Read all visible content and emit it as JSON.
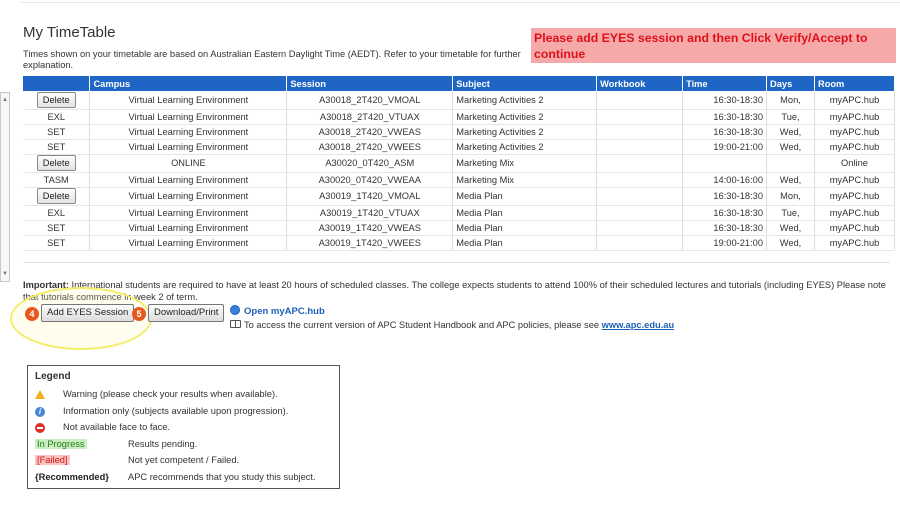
{
  "page": {
    "title": "My TimeTable",
    "subtitle": "Times shown on your timetable are based on Australian Eastern Daylight Time (AEDT). Refer to your timetable for further explanation.",
    "alert": "Please add EYES session and then Click Verify/Accept to continue"
  },
  "table": {
    "headers": [
      "",
      "Campus",
      "Session",
      "Subject",
      "Workbook",
      "Time",
      "Days",
      "Room"
    ],
    "rows": [
      {
        "action": "Delete",
        "campus": "Virtual Learning Environment",
        "session": "A30018_2T420_VMOAL",
        "subject": "Marketing Activities 2",
        "workbook": "",
        "time": "16:30-18:30",
        "days": "Mon,",
        "room": "myAPC.hub"
      },
      {
        "action": "EXL",
        "campus": "Virtual Learning Environment",
        "session": "A30018_2T420_VTUAX",
        "subject": "Marketing Activities 2",
        "workbook": "",
        "time": "16:30-18:30",
        "days": "Tue,",
        "room": "myAPC.hub"
      },
      {
        "action": "SET",
        "campus": "Virtual Learning Environment",
        "session": "A30018_2T420_VWEAS",
        "subject": "Marketing Activities 2",
        "workbook": "",
        "time": "16:30-18:30",
        "days": "Wed,",
        "room": "myAPC.hub"
      },
      {
        "action": "SET",
        "campus": "Virtual Learning Environment",
        "session": "A30018_2T420_VWEES",
        "subject": "Marketing Activities 2",
        "workbook": "",
        "time": "19:00-21:00",
        "days": "Wed,",
        "room": "myAPC.hub"
      },
      {
        "action": "Delete",
        "campus": "ONLINE",
        "session": "A30020_0T420_ASM",
        "subject": "Marketing Mix",
        "workbook": "",
        "time": "",
        "days": "",
        "room": "Online"
      },
      {
        "action": "TASM",
        "campus": "Virtual Learning Environment",
        "session": "A30020_0T420_VWEAA",
        "subject": "Marketing Mix",
        "workbook": "",
        "time": "14:00-16:00",
        "days": "Wed,",
        "room": "myAPC.hub"
      },
      {
        "action": "Delete",
        "campus": "Virtual Learning Environment",
        "session": "A30019_1T420_VMOAL",
        "subject": "Media Plan",
        "workbook": "",
        "time": "16:30-18:30",
        "days": "Mon,",
        "room": "myAPC.hub"
      },
      {
        "action": "EXL",
        "campus": "Virtual Learning Environment",
        "session": "A30019_1T420_VTUAX",
        "subject": "Media Plan",
        "workbook": "",
        "time": "16:30-18:30",
        "days": "Tue,",
        "room": "myAPC.hub"
      },
      {
        "action": "SET",
        "campus": "Virtual Learning Environment",
        "session": "A30019_1T420_VWEAS",
        "subject": "Media Plan",
        "workbook": "",
        "time": "16:30-18:30",
        "days": "Wed,",
        "room": "myAPC.hub"
      },
      {
        "action": "SET",
        "campus": "Virtual Learning Environment",
        "session": "A30019_1T420_VWEES",
        "subject": "Media Plan",
        "workbook": "",
        "time": "19:00-21:00",
        "days": "Wed,",
        "room": "myAPC.hub"
      }
    ]
  },
  "note": {
    "bold": "Important:",
    "text": " International students are required to have at least 20 hours of scheduled classes. The college expects students to attend 100% of their scheduled lectures and tutorials (including EYES) Please note that tutorials commence in week 2 of term."
  },
  "actions": {
    "step_a": "4",
    "add_eyes": "Add EYES Session",
    "step_b": "5",
    "download": "Download/Print",
    "open_link": "Open myAPC.hub",
    "handbook_text": "To access the current version of APC Student Handbook and APC policies, please see ",
    "handbook_link": "www.apc.edu.au"
  },
  "legend": {
    "title": "Legend",
    "warning": "Warning (please check your results when available).",
    "info": "Information only (subjects available upon progression).",
    "not_available": "Not available face to face.",
    "in_progress_tag": "In Progress",
    "in_progress": "Results pending.",
    "failed_tag": "[Failed]",
    "failed": "Not yet competent / Failed.",
    "recommended_tag": "{Recommended}",
    "recommended": "APC recommends that you study this subject."
  },
  "colors": {
    "header_bg": "#1f65c5",
    "alert_bg": "#f5a9a9",
    "alert_text": "#e0101a",
    "step_badge": "#e8581c",
    "link": "#1f5fb8"
  }
}
